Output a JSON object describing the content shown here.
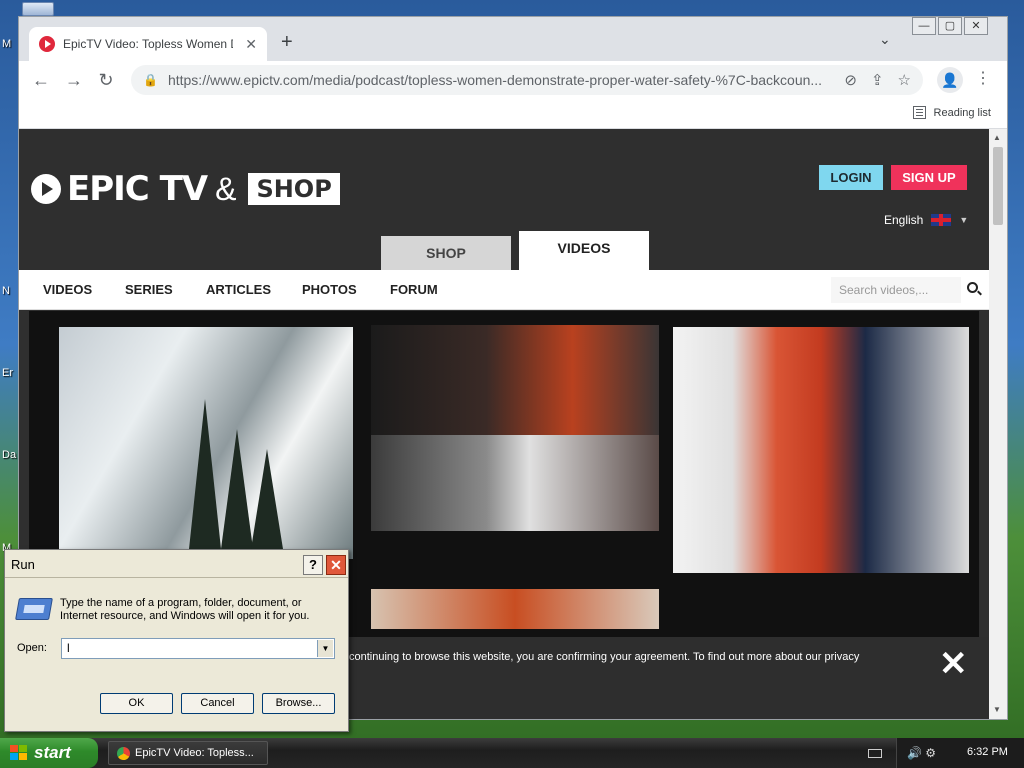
{
  "desktop": {
    "labels": [
      "M",
      "N",
      "Er",
      "Da",
      "M"
    ]
  },
  "browser": {
    "tab": {
      "title": "EpicTV Video: Topless Women Demonstrate",
      "close": "✕"
    },
    "new_tab": "+",
    "tab_search": "⌄",
    "window_controls": {
      "minimize": "—",
      "maximize": "▢",
      "close": "✕"
    },
    "nav": {
      "back": "←",
      "forward": "→",
      "reload": "↻"
    },
    "url": "https://www.epictv.com/media/podcast/topless-women-demonstrate-proper-water-safety-%7C-backcoun...",
    "omnibox_icons": {
      "lock": "🔒",
      "eye_off": "⊘",
      "share": "⇪",
      "star": "☆"
    },
    "profile": "👤",
    "menu": "⋮",
    "reading_list": "Reading list"
  },
  "site": {
    "logo_text": "EPIC TV",
    "logo_amp": "&",
    "logo_shop": "SHOP",
    "login": "LOGIN",
    "signup": "SIGN UP",
    "language": "English",
    "top_tabs": {
      "shop": "SHOP",
      "videos": "VIDEOS"
    },
    "subnav": [
      "VIDEOS",
      "SERIES",
      "ARTICLES",
      "PHOTOS",
      "FORUM"
    ],
    "search_placeholder": "Search videos,...",
    "cookie_text": "continuing to browse this website, you are confirming your agreement. To find out more about our privacy",
    "cookie_close": "✕"
  },
  "run_dialog": {
    "title": "Run",
    "help": "?",
    "close": "✕",
    "description": "Type the name of a program, folder, document, or Internet resource, and Windows will open it for you.",
    "open_label": "Open:",
    "open_value": "l",
    "ok": "OK",
    "cancel": "Cancel",
    "browse": "Browse..."
  },
  "taskbar": {
    "start": "start",
    "item": "EpicTV Video: Topless...",
    "clock": "6:32 PM",
    "tray_icons": "🔊 ⚙"
  },
  "colors": {
    "login_bg": "#7fd7ef",
    "signup_bg": "#f0325b",
    "page_bg": "#2f2f2f",
    "start_green": "#2e8a2a"
  }
}
